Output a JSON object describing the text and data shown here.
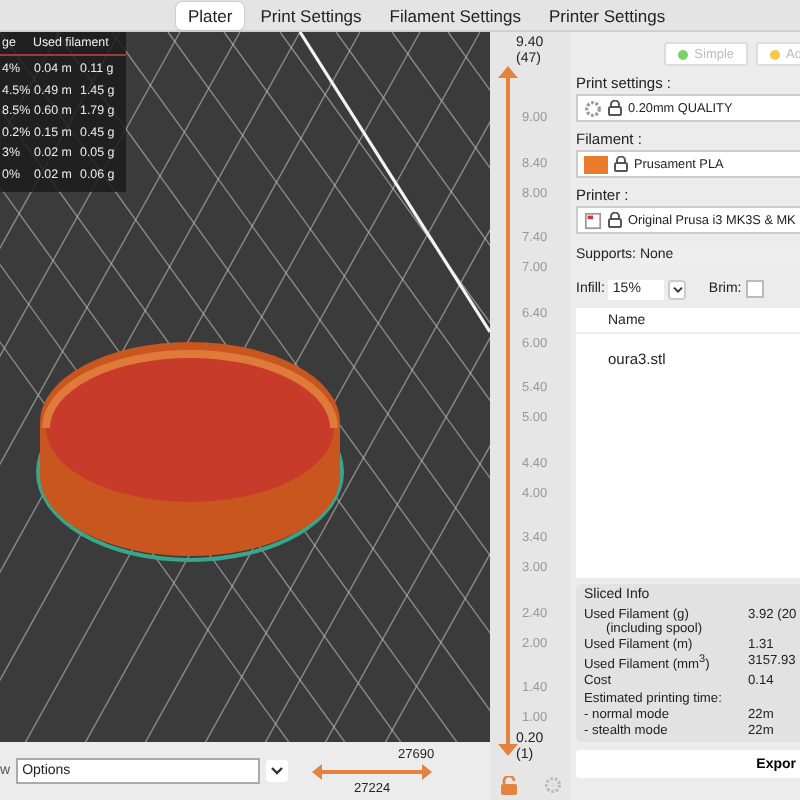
{
  "tabs": [
    {
      "label": "Plater",
      "selected": true
    },
    {
      "label": "Print Settings",
      "selected": false
    },
    {
      "label": "Filament Settings",
      "selected": false
    },
    {
      "label": "Printer Settings",
      "selected": false
    }
  ],
  "legend": {
    "columns": [
      "ge",
      "Used filament"
    ],
    "rows": [
      {
        "share": "4%",
        "length": "0.04 m",
        "weight": "0.11 g"
      },
      {
        "share": "4.5%",
        "length": "0.49 m",
        "weight": "1.45 g"
      },
      {
        "share": "8.5%",
        "length": "0.60 m",
        "weight": "1.79 g"
      },
      {
        "share": "0.2%",
        "length": "0.15 m",
        "weight": "0.45 g"
      },
      {
        "share": "3%",
        "length": "0.02 m",
        "weight": "0.05 g"
      },
      {
        "share": "0%",
        "length": "0.02 m",
        "weight": "0.06 g"
      }
    ]
  },
  "layer_slider": {
    "level": 1,
    "top_value": "9.40",
    "top_layer": "(47)",
    "ticks": [
      "9.00",
      "8.40",
      "8.00",
      "7.40",
      "7.00",
      "6.40",
      "6.00",
      "5.40",
      "5.00",
      "4.40",
      "4.00",
      "3.40",
      "3.00",
      "2.40",
      "2.00",
      "1.40",
      "1.00"
    ],
    "bottom_value": "0.20",
    "bottom_layer": "(1)"
  },
  "view_bar": {
    "label": "w",
    "combo": "Options",
    "level": 1,
    "move_upper": "27690",
    "move_lower": "27224"
  },
  "sidebar": {
    "modes": [
      {
        "label": "Simple",
        "color": "#7ad26a"
      },
      {
        "label": "Ad",
        "color": "#f2c94c"
      }
    ],
    "presets": [
      {
        "kind": "print",
        "label": "Print settings :",
        "value": "0.20mm QUALITY"
      },
      {
        "kind": "filament",
        "label": "Filament :",
        "value": "Prusament PLA",
        "color": "#ea7a2c"
      },
      {
        "kind": "printer",
        "label": "Printer :",
        "value": "Original Prusa i3 MK3S & MK"
      }
    ],
    "supports": {
      "label": "Supports:",
      "value": "None"
    },
    "infill": {
      "label": "Infill:",
      "value": "15%"
    },
    "brim": {
      "label": "Brim:",
      "checked": false
    },
    "objects": {
      "column": "Name",
      "rows": [
        "oura3.stl"
      ]
    },
    "sliced_info": {
      "title": "Sliced Info",
      "rows": [
        {
          "kind": "row",
          "label": "Used Filament (g)",
          "sub": "(including spool)",
          "value": "3.92 (20"
        },
        {
          "kind": "row",
          "label": "Used Filament (m)",
          "value": "1.31"
        },
        {
          "kind": "row",
          "label": "Used Filament (mm$^{3}$)",
          "value": "3157.93"
        },
        {
          "kind": "row",
          "label": "Cost",
          "value": "0.14"
        },
        {
          "kind": "heading",
          "label": "Estimated printing time:"
        },
        {
          "kind": "row",
          "label": "- normal mode",
          "value": "22m"
        },
        {
          "kind": "row",
          "label": "- stealth mode",
          "value": "22m"
        }
      ]
    },
    "export_button": "Expor"
  }
}
